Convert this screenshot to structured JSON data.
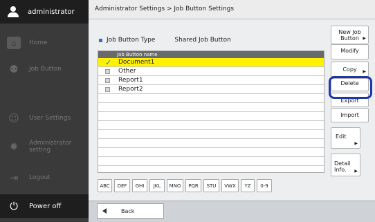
{
  "sidebar": {
    "user": "administrator",
    "items": [
      {
        "label": "Home",
        "icon": "home-icon"
      },
      {
        "label": "Job Button",
        "icon": "job-button-icon"
      },
      {
        "label": "User Settings",
        "icon": "user-settings-icon"
      },
      {
        "label": "Administrator setting",
        "icon": "gear-icon"
      },
      {
        "label": "Logout",
        "icon": "logout-icon"
      }
    ],
    "power": "Power off"
  },
  "breadcrumb": "Administrator Settings > Job Button Settings",
  "type_row": {
    "label": "Job Button Type",
    "value": "Shared Job Button"
  },
  "list": {
    "header": "Job Button name",
    "rows": [
      {
        "name": "Document1",
        "selected": true
      },
      {
        "name": "Other",
        "selected": false
      },
      {
        "name": "Report1",
        "selected": false
      },
      {
        "name": "Report2",
        "selected": false
      }
    ]
  },
  "alpha_filters": [
    "ABC",
    "DEF",
    "GHI",
    "JKL",
    "MNO",
    "PQR",
    "STU",
    "VWX",
    "YZ",
    "0-9"
  ],
  "side_buttons": {
    "new_job_button": "New Job Button",
    "modify": "Modify",
    "copy": "Copy",
    "delete": "Delete",
    "export": "Export",
    "import": "Import",
    "edit": "Edit",
    "detail_info": "Detail Info."
  },
  "back": "Back",
  "colors": {
    "selected_row": "#fff100",
    "highlight": "#1f36a8",
    "check": "#1a74d8"
  }
}
